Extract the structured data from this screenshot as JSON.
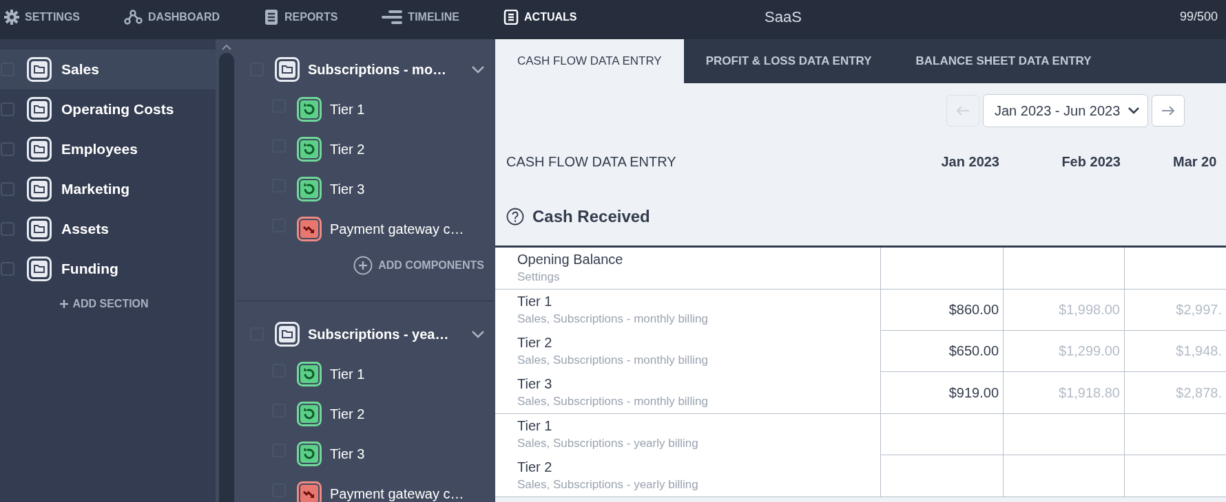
{
  "nav": {
    "items": [
      {
        "label": "SETTINGS",
        "selected": false
      },
      {
        "label": "DASHBOARD",
        "selected": false
      },
      {
        "label": "REPORTS",
        "selected": false
      },
      {
        "label": "TIMELINE",
        "selected": false
      },
      {
        "label": "ACTUALS",
        "selected": true
      }
    ],
    "title": "SaaS",
    "counter": "99/500"
  },
  "sidebar": {
    "items": [
      {
        "label": "Sales",
        "selected": true,
        "checked": false
      },
      {
        "label": "Operating Costs",
        "selected": false,
        "checked": false
      },
      {
        "label": "Employees",
        "selected": false,
        "checked": false
      },
      {
        "label": "Marketing",
        "selected": false,
        "checked": false
      },
      {
        "label": "Assets",
        "selected": false,
        "checked": false
      },
      {
        "label": "Funding",
        "selected": false,
        "checked": false
      }
    ],
    "add_label": "ADD SECTION"
  },
  "components": {
    "groups": [
      {
        "title": "Subscriptions - mo…",
        "checked": false,
        "expanded": true,
        "items": [
          {
            "label": "Tier 1",
            "kind": "revenue",
            "checked": false
          },
          {
            "label": "Tier 2",
            "kind": "revenue",
            "checked": false
          },
          {
            "label": "Tier 3",
            "kind": "revenue",
            "checked": false
          },
          {
            "label": "Payment gateway c…",
            "kind": "cost",
            "checked": false
          }
        ],
        "add_label": "ADD COMPONENTS"
      },
      {
        "title": "Subscriptions - yea…",
        "checked": false,
        "expanded": true,
        "items": [
          {
            "label": "Tier 1",
            "kind": "revenue",
            "checked": false
          },
          {
            "label": "Tier 2",
            "kind": "revenue",
            "checked": false
          },
          {
            "label": "Tier 3",
            "kind": "revenue",
            "checked": false
          },
          {
            "label": "Payment gateway c…",
            "kind": "cost",
            "checked": false
          }
        ]
      }
    ]
  },
  "main": {
    "tabs": [
      {
        "label": "CASH FLOW DATA ENTRY",
        "selected": true
      },
      {
        "label": "PROFIT & LOSS DATA ENTRY",
        "selected": false
      },
      {
        "label": "BALANCE SHEET DATA ENTRY",
        "selected": false
      }
    ],
    "period": {
      "value": "Jan 2023 - Jun 2023",
      "prev_disabled": true,
      "next_disabled": false
    },
    "table": {
      "title": "CASH FLOW DATA ENTRY",
      "columns": [
        "Jan 2023",
        "Feb 2023",
        "Mar 20"
      ],
      "section": "Cash Received",
      "groups": [
        {
          "rows": [
            {
              "label": "Opening Balance",
              "sublabel": "Settings",
              "values": []
            }
          ]
        },
        {
          "rows": [
            {
              "label": "Tier 1",
              "sublabel": "Sales, Subscriptions - monthly billing",
              "values": [
                {
                  "text": "$860.00",
                  "entered": true
                },
                {
                  "text": "$1,998.00",
                  "entered": false
                },
                {
                  "text": "$2,997.",
                  "entered": false
                }
              ]
            },
            {
              "label": "Tier 2",
              "sublabel": "Sales, Subscriptions - monthly billing",
              "values": [
                {
                  "text": "$650.00",
                  "entered": true
                },
                {
                  "text": "$1,299.00",
                  "entered": false
                },
                {
                  "text": "$1,948.",
                  "entered": false
                }
              ]
            },
            {
              "label": "Tier 3",
              "sublabel": "Sales, Subscriptions - monthly billing",
              "values": [
                {
                  "text": "$919.00",
                  "entered": true
                },
                {
                  "text": "$1,918.80",
                  "entered": false
                },
                {
                  "text": "$2,878.",
                  "entered": false
                }
              ]
            }
          ]
        },
        {
          "rows": [
            {
              "label": "Tier 1",
              "sublabel": "Sales, Subscriptions - yearly billing",
              "values": []
            },
            {
              "label": "Tier 2",
              "sublabel": "Sales, Subscriptions - yearly billing",
              "values": []
            }
          ]
        }
      ]
    }
  }
}
